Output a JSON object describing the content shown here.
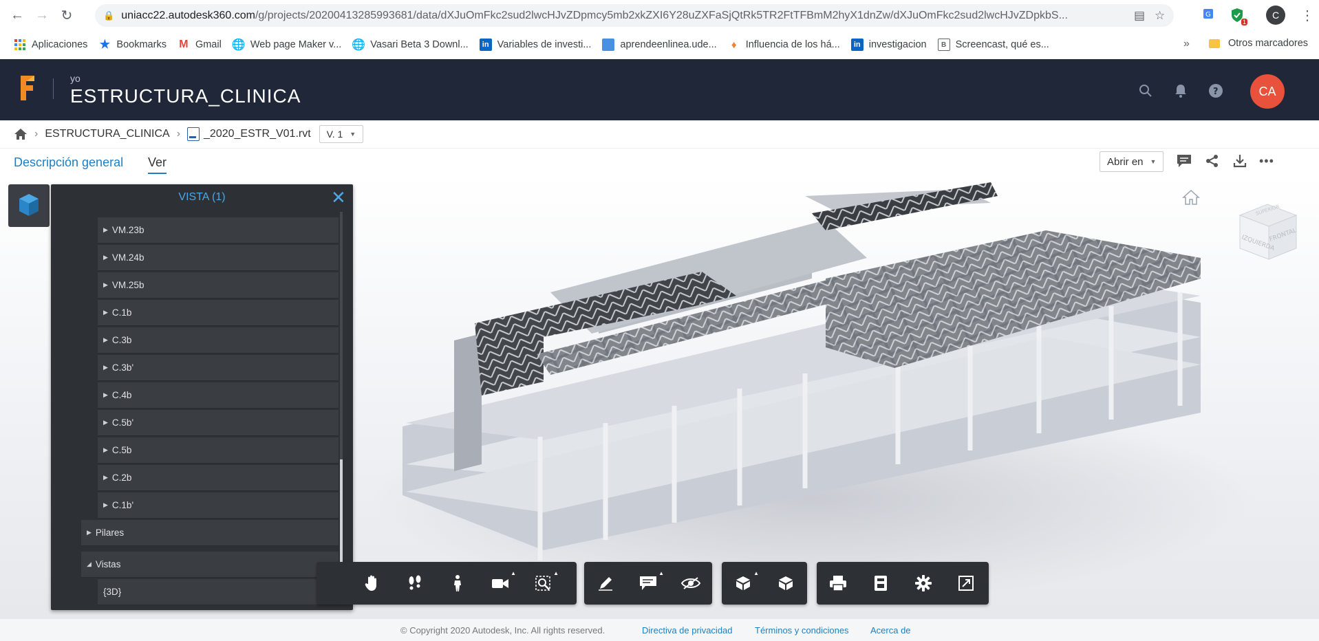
{
  "browser": {
    "url_host": "uniacc22.autodesk360.com",
    "url_path": "/g/projects/20200413285993681/data/dXJuOmFkc2sud2lwcHJvZDpmcy5mb2xkZXI6Y28uZXFaSjQtRk5TR2FtTFBmM2hyX1dnZw/dXJuOmFkc2sud2lwcHJvZDpkbS..."
  },
  "bookmarks": {
    "items": [
      {
        "label": "Aplicaciones",
        "icon": "apps-grid-icon",
        "color": "#4285f4"
      },
      {
        "label": "Bookmarks",
        "icon": "star-icon",
        "color": "#1a73e8"
      },
      {
        "label": "Gmail",
        "icon": "gmail-icon",
        "color": "#ea4335"
      },
      {
        "label": "Web page Maker v...",
        "icon": "globe-icon",
        "color": "#5f6368"
      },
      {
        "label": "Vasari Beta 3 Downl...",
        "icon": "globe-icon",
        "color": "#5f6368"
      },
      {
        "label": "Variables de investi...",
        "icon": "linkedin-icon",
        "color": "#0a66c2"
      },
      {
        "label": "aprendeenlinea.ude...",
        "icon": "cube-icon",
        "color": "#4a90e2"
      },
      {
        "label": "Influencia de los há...",
        "icon": "scholar-icon",
        "color": "#e8833a"
      },
      {
        "label": "investigacion",
        "icon": "linkedin-icon",
        "color": "#0a66c2"
      },
      {
        "label": "Screencast, qué es...",
        "icon": "book-icon",
        "color": "#5f6368"
      }
    ],
    "more": "»",
    "other": "Otros marcadores"
  },
  "profile_initial": "C",
  "extension_badge": "1",
  "header": {
    "subtitle": "yo",
    "project_title": "ESTRUCTURA_CLINICA",
    "avatar_initials": "CA"
  },
  "breadcrumb": {
    "project": "ESTRUCTURA_CLINICA",
    "file": "_2020_ESTR_V01.rvt",
    "version": "V. 1"
  },
  "tabs": {
    "overview": "Descripción general",
    "view": "Ver",
    "open_in": "Abrir en"
  },
  "panel": {
    "title": "VISTA (1)",
    "rows": [
      {
        "label": "VM.23b",
        "expandable": true
      },
      {
        "label": "VM.24b",
        "expandable": true
      },
      {
        "label": "VM.25b",
        "expandable": true
      },
      {
        "label": "C.1b",
        "expandable": true
      },
      {
        "label": "C.3b",
        "expandable": true
      },
      {
        "label": "C.3b'",
        "expandable": true
      },
      {
        "label": "C.4b",
        "expandable": true
      },
      {
        "label": "C.5b'",
        "expandable": true
      },
      {
        "label": "C.5b",
        "expandable": true
      },
      {
        "label": "C.2b",
        "expandable": true
      },
      {
        "label": "C.1b'",
        "expandable": true
      }
    ],
    "group_pilares": "Pilares",
    "group_vistas": "Vistas",
    "view_3d": "{3D}"
  },
  "viewcube": {
    "top": "SUPERIOR",
    "left": "IZQUIERDA",
    "right": "FRONTAL"
  },
  "footer": {
    "copyright": "© Copyright 2020 Autodesk, Inc. All rights reserved.",
    "privacy": "Directiva de privacidad",
    "terms": "Términos y condiciones",
    "about": "Acerca de"
  },
  "colors": {
    "header_bg": "#1f2738",
    "accent": "#1d7fc1",
    "avatar": "#e8513b",
    "panel_bg": "#2d3034"
  }
}
